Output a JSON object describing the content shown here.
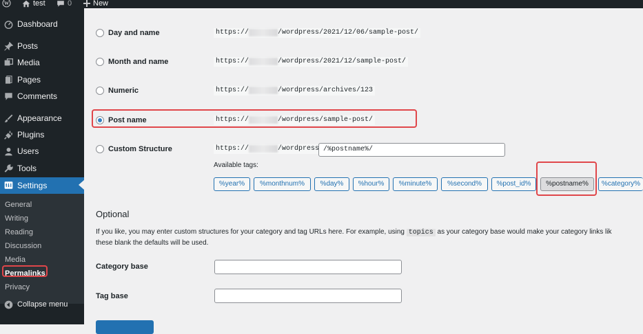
{
  "adminbar": {
    "site_name": "test",
    "comments_count": "0",
    "new_label": "New"
  },
  "sidebar": {
    "items": [
      {
        "label": "Dashboard",
        "icon": "dashboard-icon"
      },
      {
        "label": "Posts",
        "icon": "pin-icon"
      },
      {
        "label": "Media",
        "icon": "media-icon"
      },
      {
        "label": "Pages",
        "icon": "pages-icon"
      },
      {
        "label": "Comments",
        "icon": "comment-icon"
      },
      {
        "label": "Appearance",
        "icon": "brush-icon"
      },
      {
        "label": "Plugins",
        "icon": "plug-icon"
      },
      {
        "label": "Users",
        "icon": "user-icon"
      },
      {
        "label": "Tools",
        "icon": "wrench-icon"
      },
      {
        "label": "Settings",
        "icon": "settings-icon"
      }
    ],
    "submenu": [
      "General",
      "Writing",
      "Reading",
      "Discussion",
      "Media",
      "Permalinks",
      "Privacy"
    ],
    "collapse_label": "Collapse menu"
  },
  "permalinks": {
    "options": [
      {
        "label": "Day and name",
        "url_prefix": "https://",
        "url_suffix": "/wordpress/2021/12/06/sample-post/",
        "checked": false
      },
      {
        "label": "Month and name",
        "url_prefix": "https://",
        "url_suffix": "/wordpress/2021/12/sample-post/",
        "checked": false
      },
      {
        "label": "Numeric",
        "url_prefix": "https://",
        "url_suffix": "/wordpress/archives/123",
        "checked": false
      },
      {
        "label": "Post name",
        "url_prefix": "https://",
        "url_suffix": "/wordpress/sample-post/",
        "checked": true
      },
      {
        "label": "Custom Structure",
        "url_prefix": "https://",
        "url_suffix": "/wordpress",
        "checked": false
      }
    ],
    "custom_structure_value": "/%postname%/",
    "available_tags_label": "Available tags:",
    "tags": [
      "%year%",
      "%monthnum%",
      "%day%",
      "%hour%",
      "%minute%",
      "%second%",
      "%post_id%",
      "%postname%",
      "%category%"
    ],
    "selected_tag": "%postname%"
  },
  "optional": {
    "heading": "Optional",
    "description_before": "If you like, you may enter custom structures for your category and tag URLs here. For example, using ",
    "description_code": "topics",
    "description_after": " as your category base would make your category links lik",
    "description_line2": "these blank the defaults will be used.",
    "category_base_label": "Category base",
    "category_base_value": "",
    "tag_base_label": "Tag base",
    "tag_base_value": ""
  },
  "colors": {
    "accent": "#2271b1",
    "highlight_box": "#e0464a",
    "sidebar_bg": "#1d2327"
  }
}
